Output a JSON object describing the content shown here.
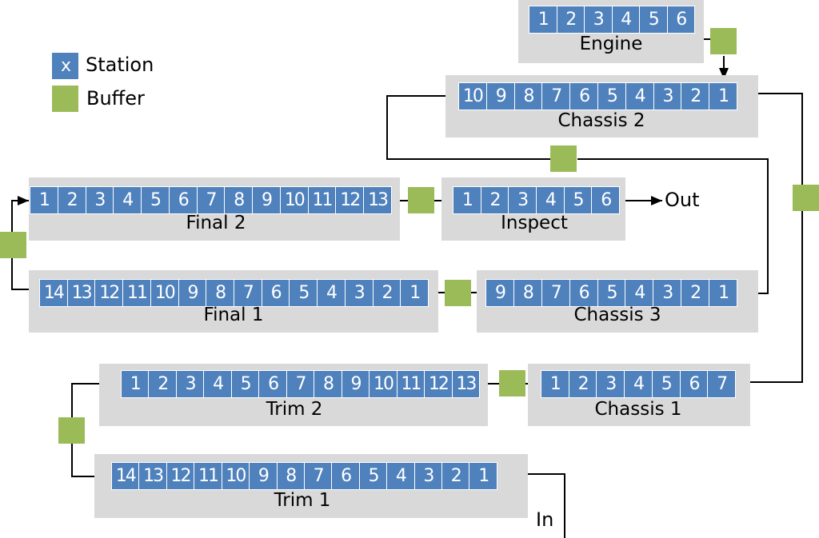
{
  "legend": {
    "station_marker": "x",
    "station_label": "Station",
    "buffer_label": "Buffer"
  },
  "colors": {
    "station": "#4f81bd",
    "buffer": "#9bbb59",
    "area": "#d9d9d9"
  },
  "stations": {
    "engine": {
      "name": "Engine",
      "cells": [
        "1",
        "2",
        "3",
        "4",
        "5",
        "6"
      ]
    },
    "chassis2": {
      "name": "Chassis 2",
      "cells": [
        "10",
        "9",
        "8",
        "7",
        "6",
        "5",
        "4",
        "3",
        "2",
        "1"
      ]
    },
    "inspect": {
      "name": "Inspect",
      "cells": [
        "1",
        "2",
        "3",
        "4",
        "5",
        "6"
      ]
    },
    "final2": {
      "name": "Final 2",
      "cells": [
        "1",
        "2",
        "3",
        "4",
        "5",
        "6",
        "7",
        "8",
        "9",
        "10",
        "11",
        "12",
        "13"
      ]
    },
    "final1": {
      "name": "Final 1",
      "cells": [
        "14",
        "13",
        "12",
        "11",
        "10",
        "9",
        "8",
        "7",
        "6",
        "5",
        "4",
        "3",
        "2",
        "1"
      ]
    },
    "chassis3": {
      "name": "Chassis 3",
      "cells": [
        "9",
        "8",
        "7",
        "6",
        "5",
        "4",
        "3",
        "2",
        "1"
      ]
    },
    "trim2": {
      "name": "Trim 2",
      "cells": [
        "1",
        "2",
        "3",
        "4",
        "5",
        "6",
        "7",
        "8",
        "9",
        "10",
        "11",
        "12",
        "13"
      ]
    },
    "chassis1": {
      "name": "Chassis 1",
      "cells": [
        "1",
        "2",
        "3",
        "4",
        "5",
        "6",
        "7"
      ]
    },
    "trim1": {
      "name": "Trim 1",
      "cells": [
        "14",
        "13",
        "12",
        "11",
        "10",
        "9",
        "8",
        "7",
        "6",
        "5",
        "4",
        "3",
        "2",
        "1"
      ]
    }
  },
  "flow": {
    "in_label": "In",
    "out_label": "Out"
  }
}
